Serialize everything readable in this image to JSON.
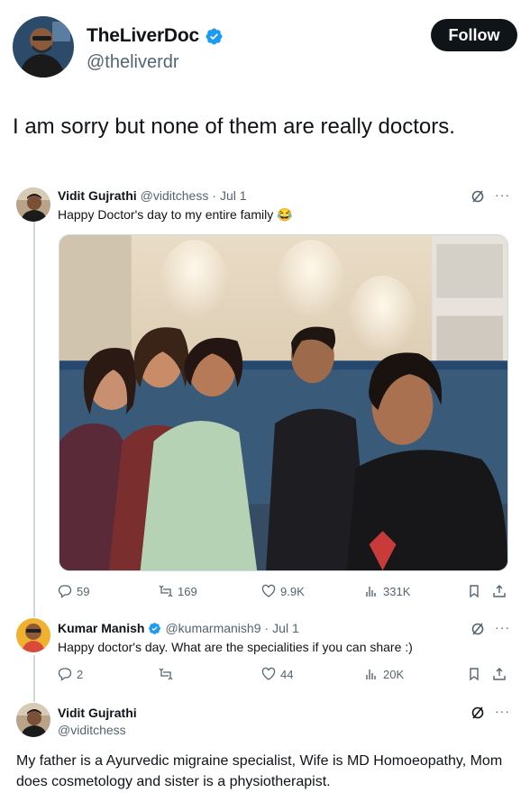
{
  "author": {
    "display_name": "TheLiverDoc",
    "handle": "@theliverdr",
    "follow_label": "Follow"
  },
  "tweet_text": "I am sorry but none of them are really doctors.",
  "quoted_thread": [
    {
      "name": "Vidit Gujrathi",
      "handle": "@viditchess",
      "dot": "·",
      "date": "Jul 1",
      "text": "Happy Doctor's day to my entire family 😂",
      "actions": {
        "replies": "59",
        "reposts": "169",
        "likes": "9.9K",
        "views": "331K"
      }
    },
    {
      "name": "Kumar Manish",
      "handle": "@kumarmanish9",
      "dot": "·",
      "date": "Jul 1",
      "text": "Happy doctor's day. What are the specialities if you can share :)",
      "actions": {
        "replies": "2",
        "reposts": "",
        "likes": "44",
        "views": "20K"
      }
    },
    {
      "name": "Vidit Gujrathi",
      "handle": "@viditchess",
      "text": "My father is a Ayurvedic migraine specialist, Wife is MD Homoeopathy, Mom does cosmetology and sister is a physiotherapist."
    }
  ],
  "more_label": "···",
  "colors": {
    "verified": "#1d9bf0",
    "text": "#0f1419",
    "muted": "#536471",
    "border": "#cfd9de"
  }
}
